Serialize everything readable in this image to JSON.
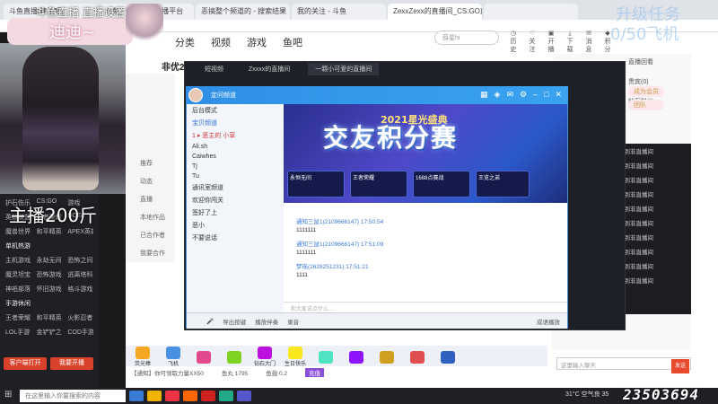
{
  "browser": {
    "tabs": [
      "斗鱼直播[建设吧]",
      "斗鱼 - 每个人的直播平台",
      "恶搞整个频道的 - 搜索结果",
      "我的关注 - 斗鱼",
      "ZexxZexx的直播间_CS:GO直播_斗...",
      ""
    ]
  },
  "overlay": {
    "top_title": "斗鱼直播 直播设置",
    "streamer_name": "迪迪~",
    "host_label": "主播200斤",
    "upgrade_text": "升级任务",
    "progress_text": "0/50飞机"
  },
  "site": {
    "nav": [
      "分类",
      "视频",
      "游戏",
      "鱼吧"
    ],
    "search_placeholder": "薛星hi",
    "icons": [
      "历史",
      "关注",
      "开播",
      "下载",
      "消息",
      "积分"
    ],
    "streamer_title": "非优2000",
    "left_menu": [
      "推荐",
      "动态",
      "直播",
      "本地作品",
      "已合作者",
      "我要合作"
    ]
  },
  "left_sidebar": {
    "rows": [
      [
        "护石伤乐",
        "CS:GO",
        "游戏"
      ],
      [
        "英雄联盟",
        "王者荣耀",
        "DOTA"
      ],
      [
        "魔兽世界",
        "和平精英",
        "APEX英雄"
      ],
      [
        "单机热游",
        "",
        ""
      ],
      [
        "主机游戏",
        "永劫无间",
        "恐怖之间"
      ],
      [
        "魔灵坦宝",
        "恐怖游戏",
        "逃离塔科夫"
      ],
      [
        "神祇部落",
        "怀旧游戏",
        "格斗游戏"
      ],
      [
        "手游休闲",
        "",
        ""
      ],
      [
        "王者荣耀",
        "和平精英",
        "火影忍者"
      ],
      [
        "LOL手游",
        "金铲铲之战",
        "COD手游"
      ]
    ],
    "buttons": [
      "客户端打开",
      "我要开播"
    ]
  },
  "client": {
    "tabs": [
      "短视频",
      "Zxxxx的直播间",
      "一颗小可爱的直播间"
    ]
  },
  "yy": {
    "title": "定问频道",
    "tree": [
      "后台模式",
      "宝贝频道",
      "1 ▸ 恶主的 小草",
      "Ali.sh",
      "Caiwhes",
      "Tj",
      "Tu",
      "通讯室频道",
      "欢迎你闯关",
      "签好了上",
      "恶小",
      "不要说话"
    ],
    "banner_title": "交友积分赛",
    "banner_sub": "2021星光盛典",
    "banner_cards": [
      "永恒无间",
      "王者荣耀",
      "1688点赛战",
      "王览之弟"
    ],
    "chat": [
      {
        "meta": "通知三鼠1(2109666147)  17:50:54",
        "text": "1111111"
      },
      {
        "meta": "通知三鼠1(2109666147)  17:51:09",
        "text": "1111111"
      },
      {
        "meta": "梦瑶(2628251231)  17:51:21",
        "text": "1111"
      }
    ],
    "input_placeholder": "和大家说点什么...",
    "bottom_buttons": [
      "导出按键",
      "播放伴奏",
      "录音"
    ],
    "status": "成语播放"
  },
  "right_panel": {
    "tabs": [
      "直播回看",
      "贵宾(0)",
      "钻石粉丝"
    ],
    "rank_buttons": [
      "成为会员",
      "团队"
    ],
    "chat_lines": [
      "欢迎来到非直播间",
      "欢迎来到非直播间",
      "欢迎来到非直播间",
      "欢迎来到非直播间",
      "欢迎来到非直播间",
      "欢迎来到非直播间",
      "欢迎来到非直播间",
      "欢迎来到非直播间",
      "欢迎来到非直播间",
      "欢迎来到非直播间"
    ],
    "send_placeholder": "这里输入聊天",
    "send_button": "发送"
  },
  "gift_bar": {
    "items": [
      "荧光棒",
      "飞机",
      "",
      "",
      "钻石大门",
      "生日快乐",
      "",
      "",
      "",
      "",
      ""
    ],
    "info": [
      "【通知】你可领取力量XX50",
      "鱼丸 1795",
      "鱼翅 0.2",
      "充值"
    ]
  },
  "taskbar": {
    "search_placeholder": "在这里输入你要搜索的内容",
    "weather": "31°C 空气良 35",
    "viewer_count": "23503694"
  },
  "colors": {
    "accent": "#d9432b",
    "yy_blue": "#2f8fe6",
    "banner_purple": "#4f49c9"
  }
}
